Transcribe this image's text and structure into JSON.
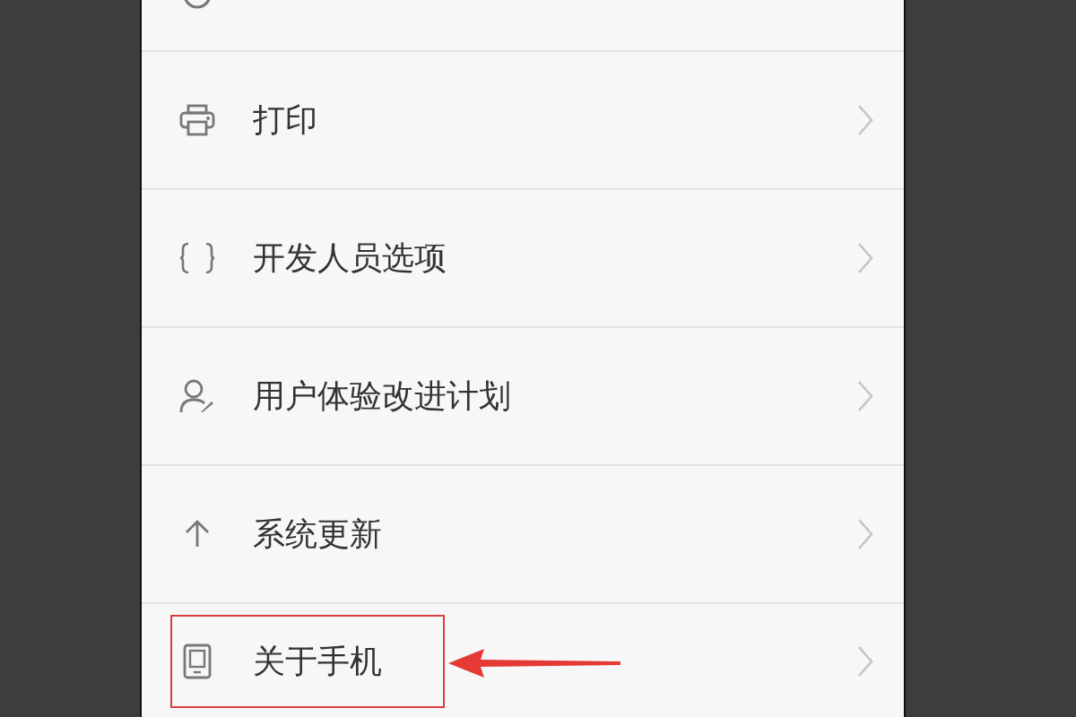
{
  "settings_list": [
    {
      "kind": "partial"
    },
    {
      "kind": "printer",
      "label": "打印",
      "highlighted": false
    },
    {
      "kind": "braces",
      "label": "开发人员选项",
      "highlighted": false
    },
    {
      "kind": "user",
      "label": "用户体验改进计划",
      "highlighted": false
    },
    {
      "kind": "update",
      "label": "系统更新",
      "highlighted": false
    },
    {
      "kind": "phone",
      "label": "关于手机",
      "highlighted": true
    }
  ]
}
